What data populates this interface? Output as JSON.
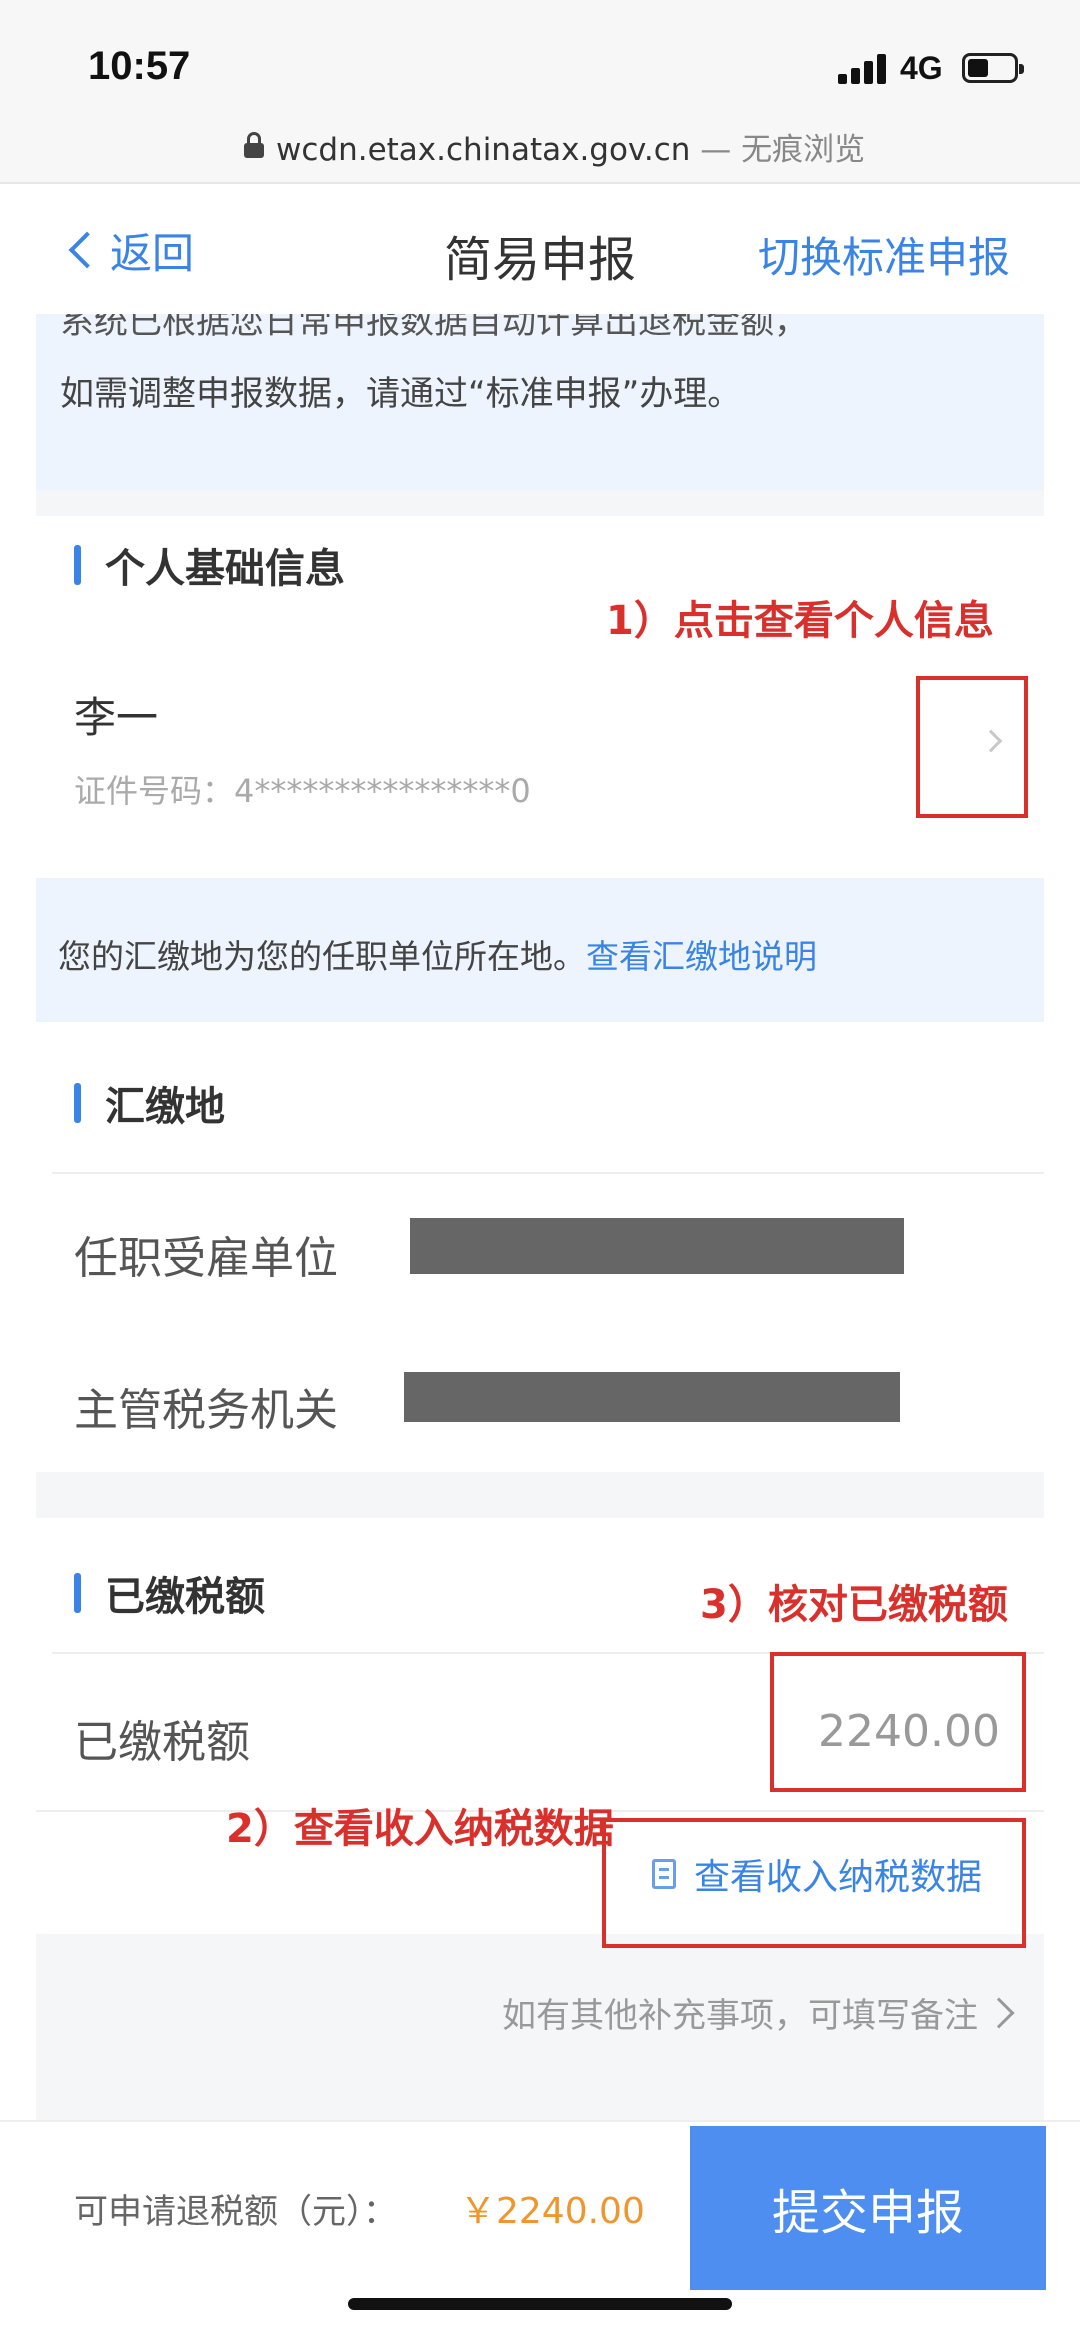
{
  "status_bar": {
    "time": "10:57",
    "network": "4G"
  },
  "url_bar": {
    "url": "wcdn.etax.chinatax.gov.cn",
    "mode": " — 无痕浏览"
  },
  "nav": {
    "back_label": "返回",
    "title": "简易申报",
    "switch_label": "切换标准申报"
  },
  "top_notice": {
    "line1": "系统已根据您日常申报数据自动计算出退税金额，",
    "line2": "如需调整申报数据，请通过“标准申报”办理。"
  },
  "personal_info": {
    "title": "个人基础信息",
    "name": "李一",
    "id_label": "证件号码：4****************0"
  },
  "remit_notice": {
    "text": "您的汇缴地为您的任职单位所在地。",
    "link": "查看汇缴地说明"
  },
  "remit_place": {
    "title": "汇缴地",
    "employer_label": "任职受雇单位",
    "tax_office_label": "主管税务机关"
  },
  "paid_tax": {
    "title": "已缴税额",
    "label": "已缴税额",
    "value": "2240.00",
    "view_data_link": "查看收入纳税数据"
  },
  "remark": {
    "text": "如有其他补充事项，可填写备注"
  },
  "footer": {
    "refund_label": "可申请退税额（元）：",
    "refund_value": "￥2240.00",
    "submit_label": "提交申报"
  },
  "annotations": {
    "step1": "1）点击查看个人信息",
    "step2": "2）查看收入纳税数据",
    "step3": "3）核对已缴税额"
  },
  "colors": {
    "accent": "#3a84e6",
    "annotation": "#d9302c",
    "refund": "#f0962e",
    "submit_bg": "#4e8ef0"
  }
}
